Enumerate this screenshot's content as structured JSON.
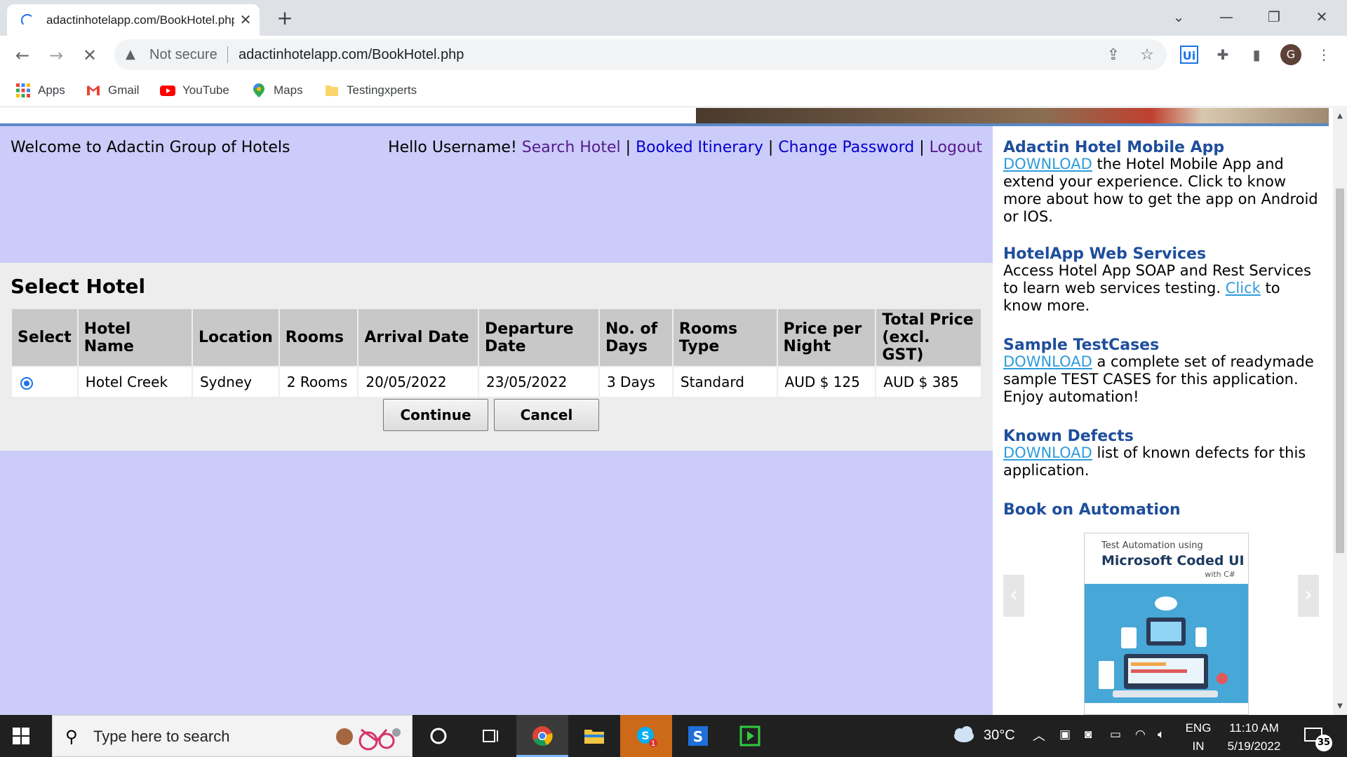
{
  "browser": {
    "tab_title": "adactinhotelapp.com/BookHotel.php",
    "new_tab": "+",
    "security_label": "Not secure",
    "url": "adactinhotelapp.com/BookHotel.php",
    "profile_initial": "G",
    "ext_ui_label": "Ui"
  },
  "bookmarks": [
    {
      "label": "Apps",
      "icon": "apps-grid-icon"
    },
    {
      "label": "Gmail",
      "icon": "gmail-icon"
    },
    {
      "label": "YouTube",
      "icon": "youtube-icon"
    },
    {
      "label": "Maps",
      "icon": "maps-pin-icon"
    },
    {
      "label": "Testingxperts",
      "icon": "folder-icon"
    }
  ],
  "header": {
    "welcome": "Welcome to Adactin Group of Hotels",
    "greeting": "Hello Username!",
    "nav": {
      "search_hotel": "Search Hotel",
      "booked_itinerary": "Booked Itinerary",
      "change_password": "Change Password",
      "logout": "Logout"
    },
    "separator": "|"
  },
  "select_hotel": {
    "title": "Select Hotel",
    "columns": [
      "Select",
      "Hotel Name",
      "Location",
      "Rooms",
      "Arrival Date",
      "Departure Date",
      "No. of Days",
      "Rooms Type",
      "Price per Night",
      "Total Price (excl. GST)"
    ],
    "rows": [
      {
        "hotel_name": "Hotel Creek",
        "location": "Sydney",
        "rooms": "2 Rooms",
        "arrival": "20/05/2022",
        "departure": "23/05/2022",
        "days": "3 Days",
        "room_type": "Standard",
        "price_per_night": "AUD $ 125",
        "total_price": "AUD $ 385",
        "selected": true
      }
    ],
    "continue_label": "Continue",
    "cancel_label": "Cancel"
  },
  "sidebar": {
    "mobile_app": {
      "title": "Adactin Hotel Mobile App",
      "link": "DOWNLOAD",
      "text": " the Hotel Mobile App and extend your experience. Click to know more about how to get the app on Android or IOS."
    },
    "web_services": {
      "title": "HotelApp Web Services",
      "text_before": "Access Hotel App SOAP and Rest Services to learn web services testing. ",
      "link": "Click",
      "text_after": " to know more."
    },
    "test_cases": {
      "title": "Sample TestCases",
      "link": "DOWNLOAD",
      "text": " a complete set of readymade sample TEST CASES for this application. Enjoy automation!"
    },
    "known_defects": {
      "title": "Known Defects",
      "link": "DOWNLOAD",
      "text": " list of known defects for this application."
    },
    "book": {
      "title": "Book on Automation",
      "cover_line1": "Test Automation using",
      "cover_line2": "Microsoft Coded UI",
      "cover_line3": "with C#"
    }
  },
  "taskbar": {
    "search_placeholder": "Type here to search",
    "weather": "30°C",
    "lang_line1": "ENG",
    "lang_line2": "IN",
    "time": "11:10 AM",
    "date": "5/19/2022",
    "notification_count": "35",
    "skype_badge": "1"
  },
  "colors": {
    "page_bg": "#ccccfa",
    "panel_bg": "#ededed",
    "header_cell": "#c8c8c8",
    "sidebar_title": "#1f4e9c",
    "link_blue": "#2d9cdb",
    "visited": "#551a8b"
  }
}
